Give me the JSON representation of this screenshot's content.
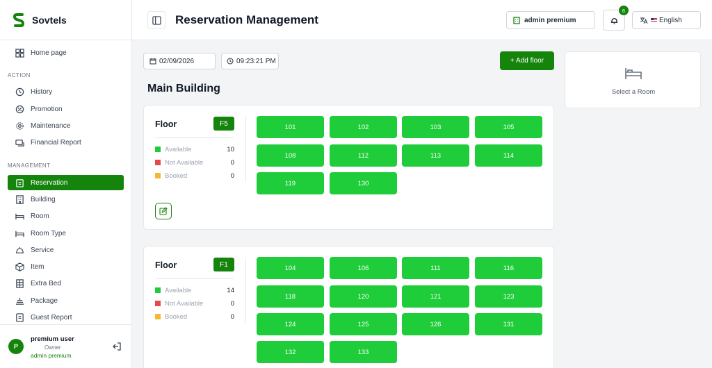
{
  "app": {
    "name": "Sovtels",
    "brand_color": "#15840c"
  },
  "sidebar": {
    "home": "Home page",
    "section_action": "ACTION",
    "action_items": [
      {
        "label": "History",
        "icon": "history-icon"
      },
      {
        "label": "Promotion",
        "icon": "promotion-icon"
      },
      {
        "label": "Maintenance",
        "icon": "gear-icon"
      },
      {
        "label": "Financial Report",
        "icon": "report-icon"
      }
    ],
    "section_management": "MANAGEMENT",
    "management_items": [
      {
        "label": "Reservation",
        "icon": "clipboard-icon",
        "active": true
      },
      {
        "label": "Building",
        "icon": "building-icon"
      },
      {
        "label": "Room",
        "icon": "bed-icon"
      },
      {
        "label": "Room Type",
        "icon": "bed-icon"
      },
      {
        "label": "Service",
        "icon": "bell-icon"
      },
      {
        "label": "Item",
        "icon": "box-icon"
      },
      {
        "label": "Extra Bed",
        "icon": "grid-icon"
      },
      {
        "label": "Package",
        "icon": "package-icon"
      },
      {
        "label": "Guest Report",
        "icon": "report-icon"
      }
    ]
  },
  "user": {
    "avatar": "P",
    "name": "premium user",
    "role": "Owner",
    "account": "admin premium"
  },
  "header": {
    "title": "Reservation Management",
    "account": "admin premium",
    "notifications": "6",
    "language": "English"
  },
  "filters": {
    "date": "02/09/2026",
    "time": "09:23:21 PM"
  },
  "add_floor": "+ Add floor",
  "building": {
    "name": "Main Building"
  },
  "stat_labels": {
    "available": "Available",
    "not_available": "Not Available",
    "booked": "Booked"
  },
  "status_colors": {
    "available": "#1fcc3a",
    "not_available": "#e5484d",
    "booked": "#f5b82e"
  },
  "floors": [
    {
      "label": "Floor",
      "badge": "F5",
      "available": "10",
      "not_available": "0",
      "booked": "0",
      "rooms": [
        "101",
        "102",
        "103",
        "105",
        "108",
        "112",
        "113",
        "114",
        "119",
        "130"
      ]
    },
    {
      "label": "Floor",
      "badge": "F1",
      "available": "14",
      "not_available": "0",
      "booked": "0",
      "rooms": [
        "104",
        "106",
        "111",
        "116",
        "118",
        "120",
        "121",
        "123",
        "124",
        "125",
        "126",
        "131",
        "132",
        "133"
      ]
    }
  ],
  "side_panel": {
    "text": "Select a Room"
  }
}
